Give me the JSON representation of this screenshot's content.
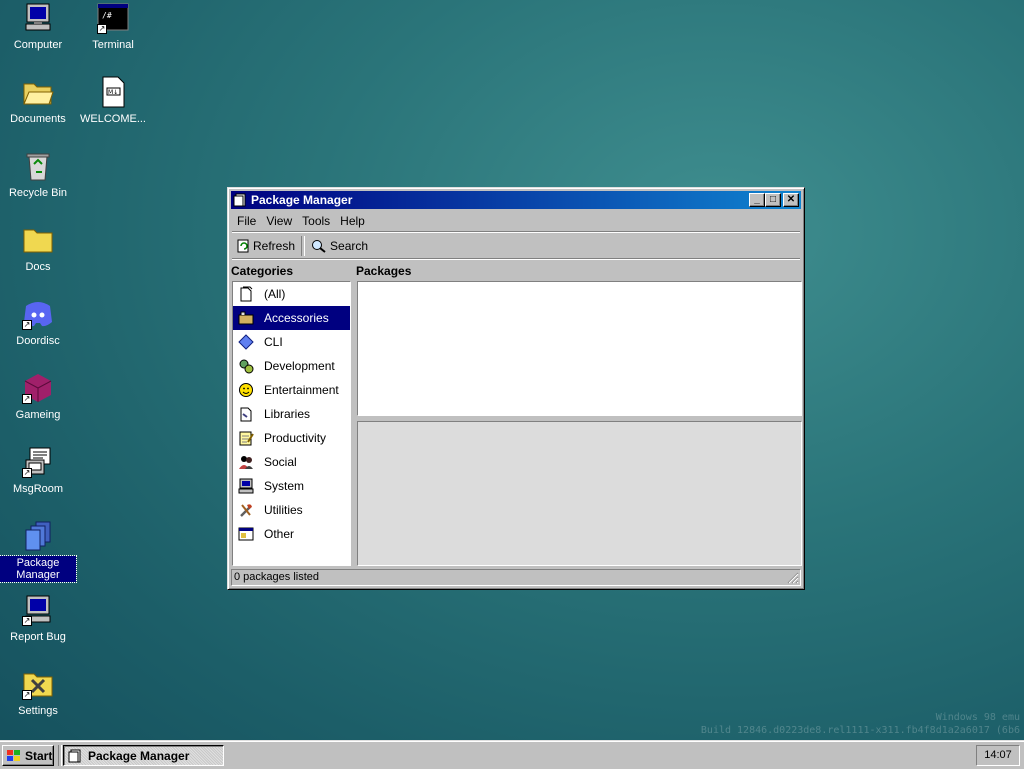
{
  "desktop": {
    "icons": [
      {
        "label": "Computer",
        "icon": "computer-icon",
        "shortcut": false
      },
      {
        "label": "Terminal",
        "icon": "terminal-icon",
        "shortcut": true
      },
      {
        "label": "Documents",
        "icon": "folder-open-icon",
        "shortcut": false
      },
      {
        "label": "WELCOME...",
        "icon": "markdown-file-icon",
        "shortcut": false
      },
      {
        "label": "Recycle Bin",
        "icon": "recycle-bin-icon",
        "shortcut": false
      },
      {
        "label": "Docs",
        "icon": "folder-icon",
        "shortcut": false
      },
      {
        "label": "Doordisc",
        "icon": "discord-icon",
        "shortcut": true
      },
      {
        "label": "Gameing",
        "icon": "cube-icon",
        "shortcut": true
      },
      {
        "label": "MsgRoom",
        "icon": "chat-computer-icon",
        "shortcut": true
      },
      {
        "label": "Package Manager",
        "icon": "package-icon",
        "shortcut": false,
        "selected": true
      },
      {
        "label": "Report Bug",
        "icon": "computer-icon",
        "shortcut": true
      },
      {
        "label": "Settings",
        "icon": "settings-folder-icon",
        "shortcut": true
      }
    ],
    "watermark_line1": "Windows 98 emu",
    "watermark_line2": "Build 12846.d0223de8.rel1111-x311.fb4f8d1a2a6017 (6b6"
  },
  "window": {
    "title": "Package Manager",
    "minimize": "_",
    "maximize": "□",
    "close": "✕",
    "menu": [
      "File",
      "View",
      "Tools",
      "Help"
    ],
    "toolbar": {
      "refresh": "Refresh",
      "search": "Search"
    },
    "categories_label": "Categories",
    "packages_label": "Packages",
    "categories": [
      {
        "label": "(All)",
        "icon": "document-icon"
      },
      {
        "label": "Accessories",
        "icon": "accessories-icon",
        "selected": true
      },
      {
        "label": "CLI",
        "icon": "diamond-icon"
      },
      {
        "label": "Development",
        "icon": "gears-icon"
      },
      {
        "label": "Entertainment",
        "icon": "smiley-icon"
      },
      {
        "label": "Libraries",
        "icon": "library-icon"
      },
      {
        "label": "Productivity",
        "icon": "notepad-icon"
      },
      {
        "label": "Social",
        "icon": "people-icon"
      },
      {
        "label": "System",
        "icon": "computer-icon"
      },
      {
        "label": "Utilities",
        "icon": "tools-icon"
      },
      {
        "label": "Other",
        "icon": "window-icon"
      }
    ],
    "status": "0 packages listed"
  },
  "taskbar": {
    "start": "Start",
    "task": "Package Manager",
    "clock": "14:07"
  },
  "colors": {
    "selection": "#000080",
    "title_start": "#000080",
    "title_end": "#1084d0",
    "face": "#c0c0c0"
  }
}
